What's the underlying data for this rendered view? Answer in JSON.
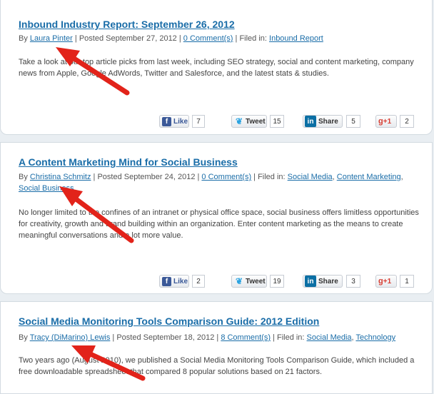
{
  "posts": [
    {
      "title": "Inbound Industry Report: September 26, 2012",
      "by": "By ",
      "author": "Laura Pinter",
      "posted": " | Posted September 27, 2012 | ",
      "comments": "0 Comment(s)",
      "filed": " | Filed in: ",
      "categories": [
        "Inbound Report"
      ],
      "excerpt": "Take a look at our top article picks from last week, including SEO strategy, social and content marketing, company news from Apple, Google AdWords, Twitter and Salesforce, and the latest stats & studies.",
      "shares": {
        "like_label": "Like",
        "like_count": "7",
        "tweet_label": "Tweet",
        "tweet_count": "15",
        "share_label": "Share",
        "share_count": "5",
        "plus_label": "+1",
        "plus_count": "2"
      }
    },
    {
      "title": "A Content Marketing Mind for Social Business",
      "by": "By ",
      "author": "Christina Schmitz",
      "posted": " | Posted September 24, 2012 | ",
      "comments": "0 Comment(s)",
      "filed": " | Filed in: ",
      "categories": [
        "Social Media",
        "Content Marketing",
        "Social Business"
      ],
      "excerpt": "No longer limited to the confines of an intranet or physical office space, social business offers limitless opportunities for creativity, growth and brand building within an organization. Enter content marketing as the means to create meaningful conversations and a lot more value.",
      "shares": {
        "like_label": "Like",
        "like_count": "2",
        "tweet_label": "Tweet",
        "tweet_count": "19",
        "share_label": "Share",
        "share_count": "3",
        "plus_label": "+1",
        "plus_count": "1"
      }
    },
    {
      "title": "Social Media Monitoring Tools Comparison Guide: 2012 Edition",
      "by": "By ",
      "author": "Tracy (DiMarino) Lewis",
      "posted": " | Posted September 18, 2012 | ",
      "comments": "8 Comment(s)",
      "filed": " | Filed in: ",
      "categories": [
        "Social Media",
        "Technology"
      ],
      "excerpt": "Two years ago (August 2010), we published a Social Media Monitoring Tools Comparison Guide, which included a free downloadable spreadsheet that compared 8 popular solutions based on 21 factors."
    }
  ],
  "separator": ", ",
  "icons": {
    "facebook": "facebook-icon",
    "twitter": "twitter-bird-icon",
    "linkedin": "linkedin-icon",
    "google_plus": "google-plus-icon"
  },
  "colors": {
    "link": "#1a6da8",
    "arrow": "#e2231a",
    "facebook": "#3b5998",
    "linkedin": "#0b6fa4",
    "google": "#d73d32"
  }
}
